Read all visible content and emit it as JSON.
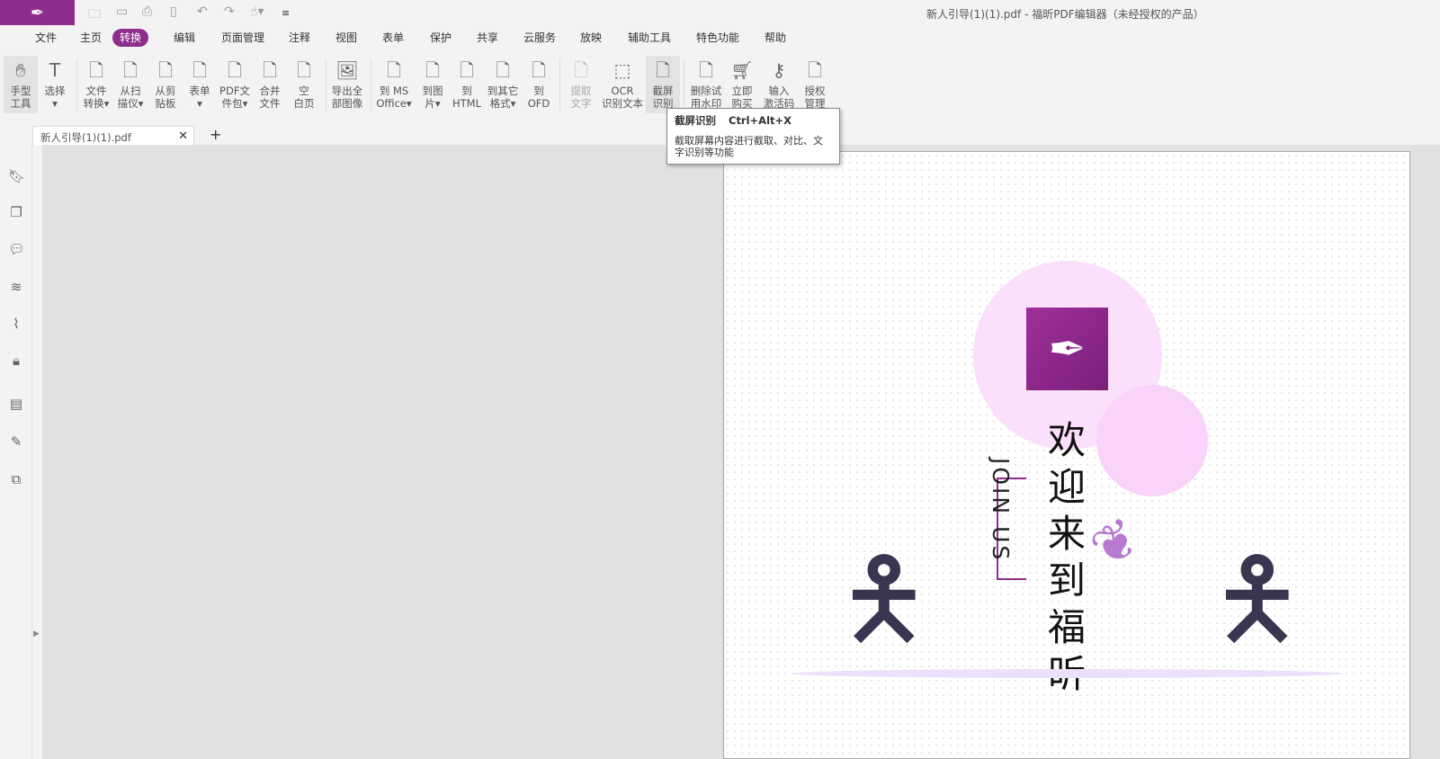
{
  "window": {
    "title": "新人引导(1)(1).pdf - 福昕PDF编辑器（未经授权的产品）"
  },
  "menu": [
    "文件",
    "主页",
    "转换",
    "编辑",
    "页面管理",
    "注释",
    "视图",
    "表单",
    "保护",
    "共享",
    "云服务",
    "放映",
    "辅助工具",
    "特色功能",
    "帮助"
  ],
  "ribbon": [
    {
      "l1": "手型",
      "l2": "工具",
      "icon": "hand-icon"
    },
    {
      "l1": "选择",
      "l2": "▾",
      "icon": "select-text-icon"
    },
    {
      "l1": "文件",
      "l2": "转换▾",
      "icon": "file-convert-icon"
    },
    {
      "l1": "从扫",
      "l2": "描仪▾",
      "icon": "scanner-icon"
    },
    {
      "l1": "从剪",
      "l2": "贴板",
      "icon": "clipboard-icon"
    },
    {
      "l1": "表单",
      "l2": "▾",
      "icon": "form-icon"
    },
    {
      "l1": "PDF文",
      "l2": "件包▾",
      "icon": "portfolio-icon"
    },
    {
      "l1": "合并",
      "l2": "文件",
      "icon": "merge-icon"
    },
    {
      "l1": "空",
      "l2": "白页",
      "icon": "blank-page-icon"
    },
    {
      "l1": "导出全",
      "l2": "部图像",
      "icon": "export-images-icon"
    },
    {
      "l1": "到 MS",
      "l2": "Office▾",
      "icon": "to-office-icon"
    },
    {
      "l1": "到图",
      "l2": "片▾",
      "icon": "to-image-icon"
    },
    {
      "l1": "到",
      "l2": "HTML",
      "icon": "to-html-icon"
    },
    {
      "l1": "到其它",
      "l2": "格式▾",
      "icon": "to-other-icon"
    },
    {
      "l1": "到",
      "l2": "OFD",
      "icon": "to-ofd-icon"
    },
    {
      "l1": "提取",
      "l2": "文字",
      "icon": "extract-text-icon"
    },
    {
      "l1": "OCR",
      "l2": "识别文本",
      "icon": "ocr-icon"
    },
    {
      "l1": "截屏",
      "l2": "识别",
      "icon": "screen-capture-icon"
    },
    {
      "l1": "删除试",
      "l2": "用水印",
      "icon": "remove-watermark-icon"
    },
    {
      "l1": "立即",
      "l2": "购买",
      "icon": "cart-icon"
    },
    {
      "l1": "输入",
      "l2": "激活码",
      "icon": "key-icon"
    },
    {
      "l1": "授权",
      "l2": "管理",
      "icon": "license-icon"
    }
  ],
  "tooltip": {
    "title": "截屏识别",
    "shortcut": "Ctrl+Alt+X",
    "desc": "截取屏幕内容进行截取、对比、文字识别等功能"
  },
  "tab": {
    "name": "新人引导(1)(1).pdf"
  },
  "page": {
    "welcome": "欢迎来到福昕",
    "join": "JOIN US"
  },
  "colors": {
    "brand": "#8e2d8e"
  }
}
